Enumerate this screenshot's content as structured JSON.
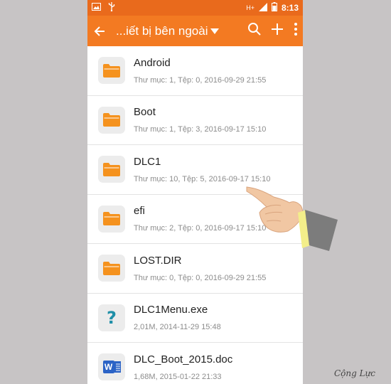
{
  "status_bar": {
    "time": "8:13",
    "network": "H+",
    "left_icons": [
      "image-icon",
      "usb-icon"
    ],
    "right_icons": [
      "signal-icon",
      "battery-icon"
    ]
  },
  "app_bar": {
    "title": "...iết bị bên ngoài",
    "icons": [
      "back-arrow-icon",
      "dropdown-triangle-icon",
      "search-icon",
      "plus-icon",
      "more-vert-icon"
    ],
    "color": "#f37a22"
  },
  "files": [
    {
      "name": "Android",
      "info": "Thư mục: 1, Tệp: 0, 2016-09-29 21:55",
      "type": "folder"
    },
    {
      "name": "Boot",
      "info": "Thư mục: 1, Tệp: 3, 2016-09-17 15:10",
      "type": "folder"
    },
    {
      "name": "DLC1",
      "info": "Thư mục: 10, Tệp: 5, 2016-09-17 15:10",
      "type": "folder"
    },
    {
      "name": "efi",
      "info": "Thư mục: 2, Tệp: 0, 2016-09-17 15:10",
      "type": "folder"
    },
    {
      "name": "LOST.DIR",
      "info": "Thư mục: 0, Tệp: 0, 2016-09-29 21:55",
      "type": "folder"
    },
    {
      "name": "DLC1Menu.exe",
      "info": "2,01M, 2014-11-29 15:48",
      "type": "unknown",
      "glyph": "?"
    },
    {
      "name": "DLC_Boot_2015.doc",
      "info": "1,68M, 2015-01-22 21:33",
      "type": "word",
      "glyph": "W"
    }
  ],
  "watermark": "Cộng Lực",
  "colors": {
    "folder": "#f5921e",
    "word": "#2b63c6",
    "unknown": "#1f8fa8"
  }
}
